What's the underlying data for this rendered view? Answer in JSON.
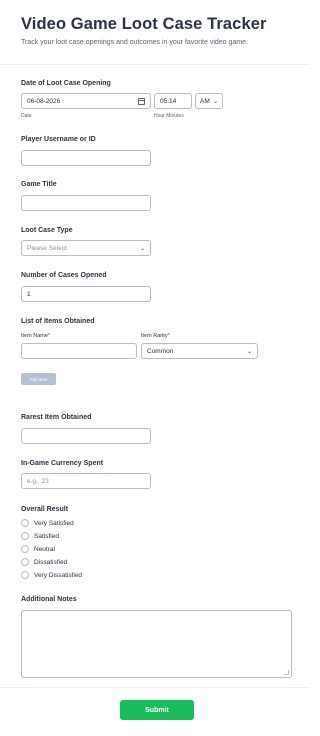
{
  "form": {
    "title": "Video Game Loot Case Tracker",
    "subtitle": "Track your loot case openings and outcomes in your favorite video game."
  },
  "date_field": {
    "label": "Date of Loot Case Opening",
    "date_value": "06-08-2026",
    "date_sublabel": "Date",
    "time_value": "05:14",
    "time_sublabel": "Hour Minutes",
    "ampm_value": "AM"
  },
  "player": {
    "label": "Player Username or ID",
    "value": ""
  },
  "game_title": {
    "label": "Game Title",
    "value": ""
  },
  "case_type": {
    "label": "Loot Case Type",
    "selected": "Please Select"
  },
  "cases_opened": {
    "label": "Number of Cases Opened",
    "value": "1"
  },
  "items": {
    "label": "List of Items Obtained",
    "name_header": "Item Name",
    "rarity_header": "Item Rarity",
    "rarity_selected": "Common",
    "add_button": "Add Item",
    "required_mark": "*"
  },
  "rarest_item": {
    "label": "Rarest Item Obtained",
    "value": ""
  },
  "currency": {
    "label": "In-Game Currency Spent",
    "placeholder": "e.g., 23"
  },
  "result": {
    "label": "Overall Result",
    "options": [
      "Very Satisfied",
      "Satisfied",
      "Neutral",
      "Dissatisfied",
      "Very Dissatisfied"
    ]
  },
  "notes": {
    "label": "Additional Notes",
    "value": ""
  },
  "submit": {
    "label": "Submit"
  },
  "colors": {
    "submit_green": "#18bd5b",
    "required_red": "#d82f2f",
    "add_button_gray": "#b5c0d3"
  },
  "icons": {
    "date_picker": "calendar-icon",
    "dropdown": "chevron-down-icon"
  }
}
